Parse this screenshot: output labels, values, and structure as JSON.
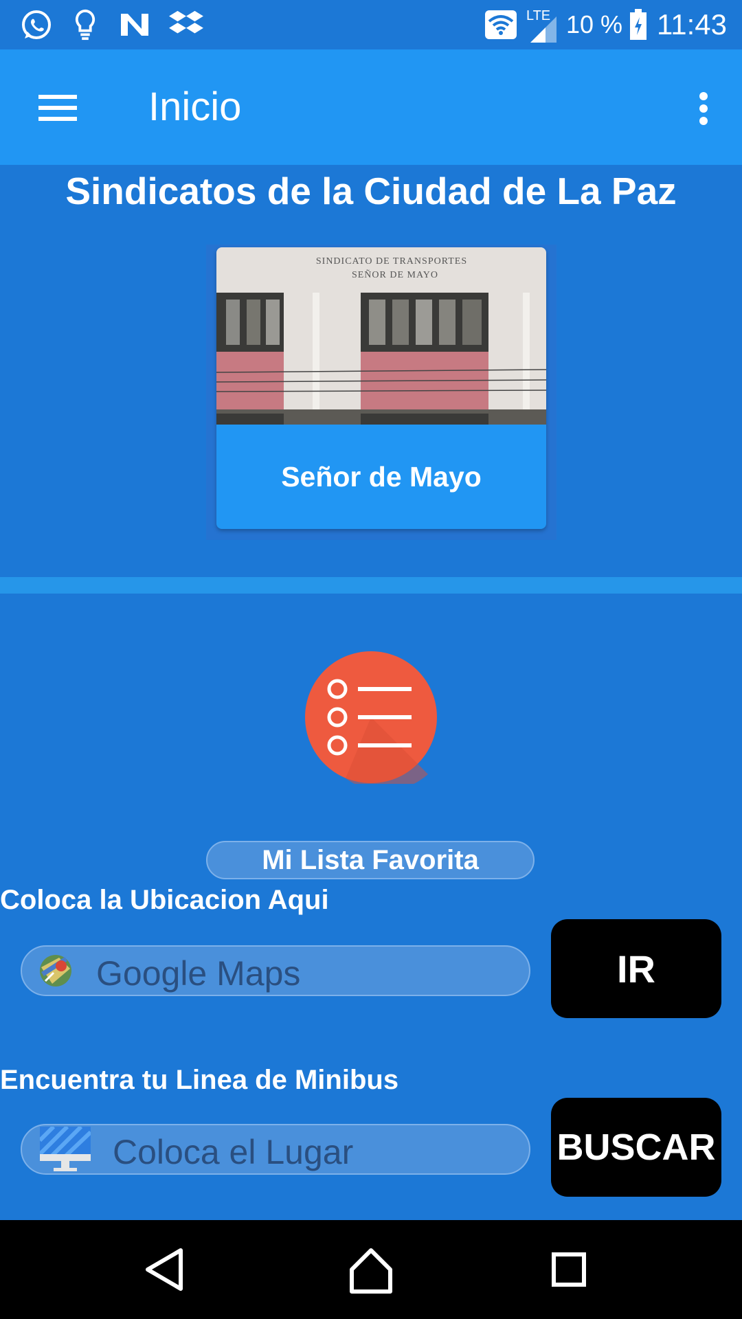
{
  "status_bar": {
    "battery_text": "10 %",
    "time": "11:43",
    "network_label": "LTE",
    "notification_icons": [
      "whatsapp-icon",
      "lightbulb-icon",
      "n-app-icon",
      "dropbox-icon"
    ]
  },
  "app_bar": {
    "title": "Inicio",
    "menu_icon": "hamburger-menu-icon",
    "overflow_icon": "more-vert-icon"
  },
  "main": {
    "section_title": "Sindicatos de la Ciudad de La Paz",
    "card": {
      "label": "Señor de Mayo",
      "image_sign_line1": "SINDICATO DE TRANSPORTES",
      "image_sign_line2": "SEÑOR DE MAYO"
    },
    "favorites_button": "Mi Lista Favorita",
    "location": {
      "label": "Coloca la Ubicacion Aqui",
      "placeholder": "Google Maps",
      "button": "IR"
    },
    "minibus": {
      "label": "Encuentra tu Linea de Minibus",
      "placeholder": "Coloca el Lugar",
      "button": "BUSCAR"
    }
  },
  "colors": {
    "background": "#1C78D6",
    "app_bar": "#2196F3",
    "list_icon": "#EE5A3F",
    "button": "#000000"
  }
}
